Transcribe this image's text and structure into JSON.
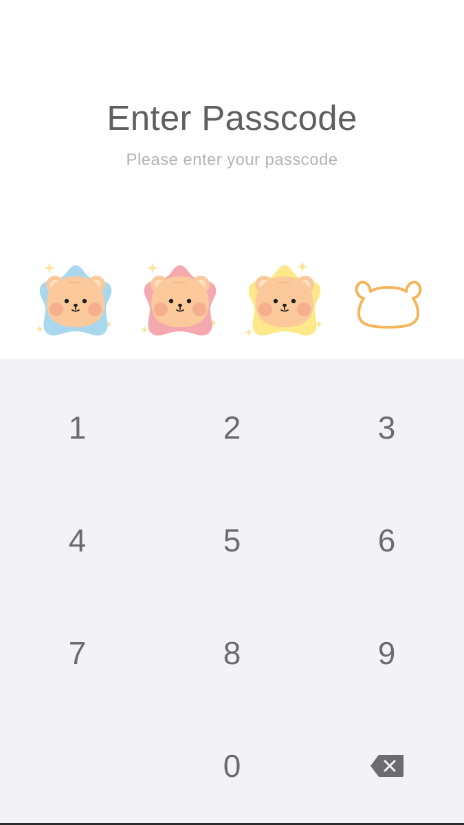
{
  "header": {
    "title": "Enter Passcode",
    "subtitle": "Please enter your passcode"
  },
  "passcode": {
    "length": 4,
    "entered": 3,
    "filled_slot_icons": [
      "bear-blue-star-icon",
      "bear-pink-star-icon",
      "bear-yellow-star-icon"
    ],
    "empty_slot_icon": "bear-outline-icon"
  },
  "keypad": {
    "keys": [
      "1",
      "2",
      "3",
      "4",
      "5",
      "6",
      "7",
      "8",
      "9",
      "",
      "0",
      "backspace"
    ],
    "backspace_icon": "backspace-icon"
  },
  "colors": {
    "keypad_bg": "#f3f2f5",
    "bear_face": "#fbc99b",
    "blue_star": "#a9d8ee",
    "pink_star": "#f4a8b0",
    "yellow_star": "#fde88a",
    "outline": "#f6b35a",
    "text": "#5f5f63",
    "subtext": "#b3b3b8"
  }
}
